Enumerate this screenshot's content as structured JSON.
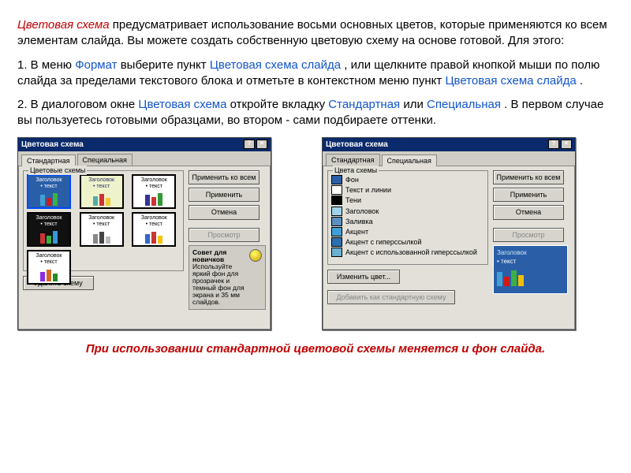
{
  "text": {
    "intro": "Цветовая схема предусматривает использование восьми основных цветов, которые применяются ко всем элементам слайда. Вы можете создать собственную цветовую схему на основе готовой. Для этого:",
    "term": "Цветовая схема",
    "p1_a": "1.  В меню ",
    "p1_format": "Формат",
    "p1_b": " выберите пункт ",
    "p1_cmd": "Цветовая схема слайда",
    "p1_c": ", или щелкните правой кнопкой мыши по полю слайда за пределами текстового блока и отметьте в контекстном меню пункт ",
    "p1_cmd2": "Цветовая схема слайда",
    "p1_d": ".",
    "p2_a": "2.  В диалоговом окне ",
    "p2_dlg": "Цветовая схема",
    "p2_b": " откройте вкладку ",
    "p2_tab1": "Стандартная",
    "p2_c": " или ",
    "p2_tab2": "Специальная",
    "p2_d": ". В первом случае вы пользуетесь готовыми образцами, во втором - сами подбираете оттенки.",
    "footer": "При использовании стандартной цветовой схемы меняется и фон слайда."
  },
  "dlg": {
    "title": "Цветовая схема",
    "tab_standard": "Стандартная",
    "tab_special": "Специальная",
    "schemes_label": "Цветовые схемы",
    "scheme_colors_label": "Цвета схемы",
    "thumb_title": "Заголовок",
    "thumb_text": "текст",
    "thumb_bullet": "• текст",
    "apply_all": "Применить ко всем",
    "apply": "Применить",
    "cancel": "Отмена",
    "preview": "Просмотр",
    "delete_scheme": "Удалить схему",
    "change_color": "Изменить цвет...",
    "add_standard": "Добавить как стандартную схему",
    "tip_title": "Совет для новичков",
    "tip_body": "Используйте яркий фон для прозрачек и темный фон для экрана и 35 мм слайдов.",
    "colors": {
      "bg": "Фон",
      "text": "Текст и линии",
      "shadow": "Тени",
      "title": "Заголовок",
      "fill": "Заливка",
      "accent": "Акцент",
      "hyper": "Акцент с гиперссылкой",
      "visited": "Акцент с использованной гиперссылкой"
    }
  }
}
